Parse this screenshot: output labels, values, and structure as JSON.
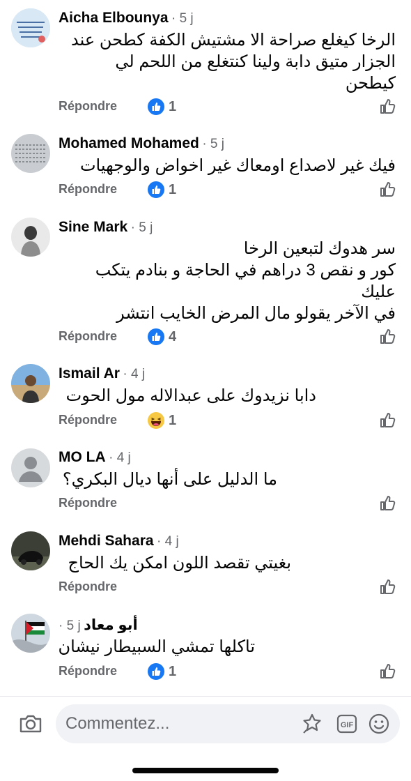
{
  "comments": [
    {
      "author": "Aicha Elbounya",
      "time": "· 5 j",
      "lines": [
        "الرخا كيغلع صراحة الا مشتيش الكفة كطحن عند",
        "الجزار متيق دابة ولينا كنتغلع من اللحم لي",
        "كيطحن"
      ],
      "reply": "Répondre",
      "reaction": "like",
      "count": "1"
    },
    {
      "author": "Mohamed Mohamed",
      "time": "· 5 j",
      "lines": [
        "فيك غير لاصداع اومعاك غير اخواض والوجهيات"
      ],
      "reply": "Répondre",
      "reaction": "like",
      "count": "1"
    },
    {
      "author": "Sine Mark",
      "time": "· 5 j",
      "lines": [
        "سر هدوك لتبعين الرخا",
        "كور و نقص 3  دراهم في الحاجة و بنادم يتكب",
        "عليك",
        "في الآخر يقولو مال المرض الخايب انتشر"
      ],
      "reply": "Répondre",
      "reaction": "like",
      "count": "4"
    },
    {
      "author": "Ismail Ar",
      "time": "· 4 j",
      "lines": [
        "دابا نزيدوك على عبدالاله مول الحوت"
      ],
      "reply": "Répondre",
      "reaction": "haha",
      "count": "1"
    },
    {
      "author": "MO LA",
      "time": "· 4 j",
      "lines": [
        "ما الدليل على أنها ديال البكري؟"
      ],
      "reply": "Répondre",
      "reaction": "",
      "count": ""
    },
    {
      "author": "Mehdi Sahara",
      "time": "· 4 j",
      "lines": [
        "بغيتي تقصد اللون امكن يك الحاج"
      ],
      "reply": "Répondre",
      "reaction": "",
      "count": ""
    },
    {
      "author": "أبو معاد",
      "time": "· 5 j",
      "lines": [
        "تاكلها تمشي السبيطار نيشان"
      ],
      "reply": "Répondre",
      "reaction": "like",
      "count": "1"
    }
  ],
  "composer": {
    "placeholder": "Commentez...",
    "gif_label": "GIF"
  },
  "colors": {
    "like_blue": "#1877f2",
    "secondary_text": "#65676b",
    "input_bg": "#f0f2f5"
  },
  "icons": [
    "camera-icon",
    "sticker-icon",
    "gif-icon",
    "emoji-icon",
    "like-reaction-icon",
    "haha-reaction-icon",
    "like-outline-icon"
  ]
}
